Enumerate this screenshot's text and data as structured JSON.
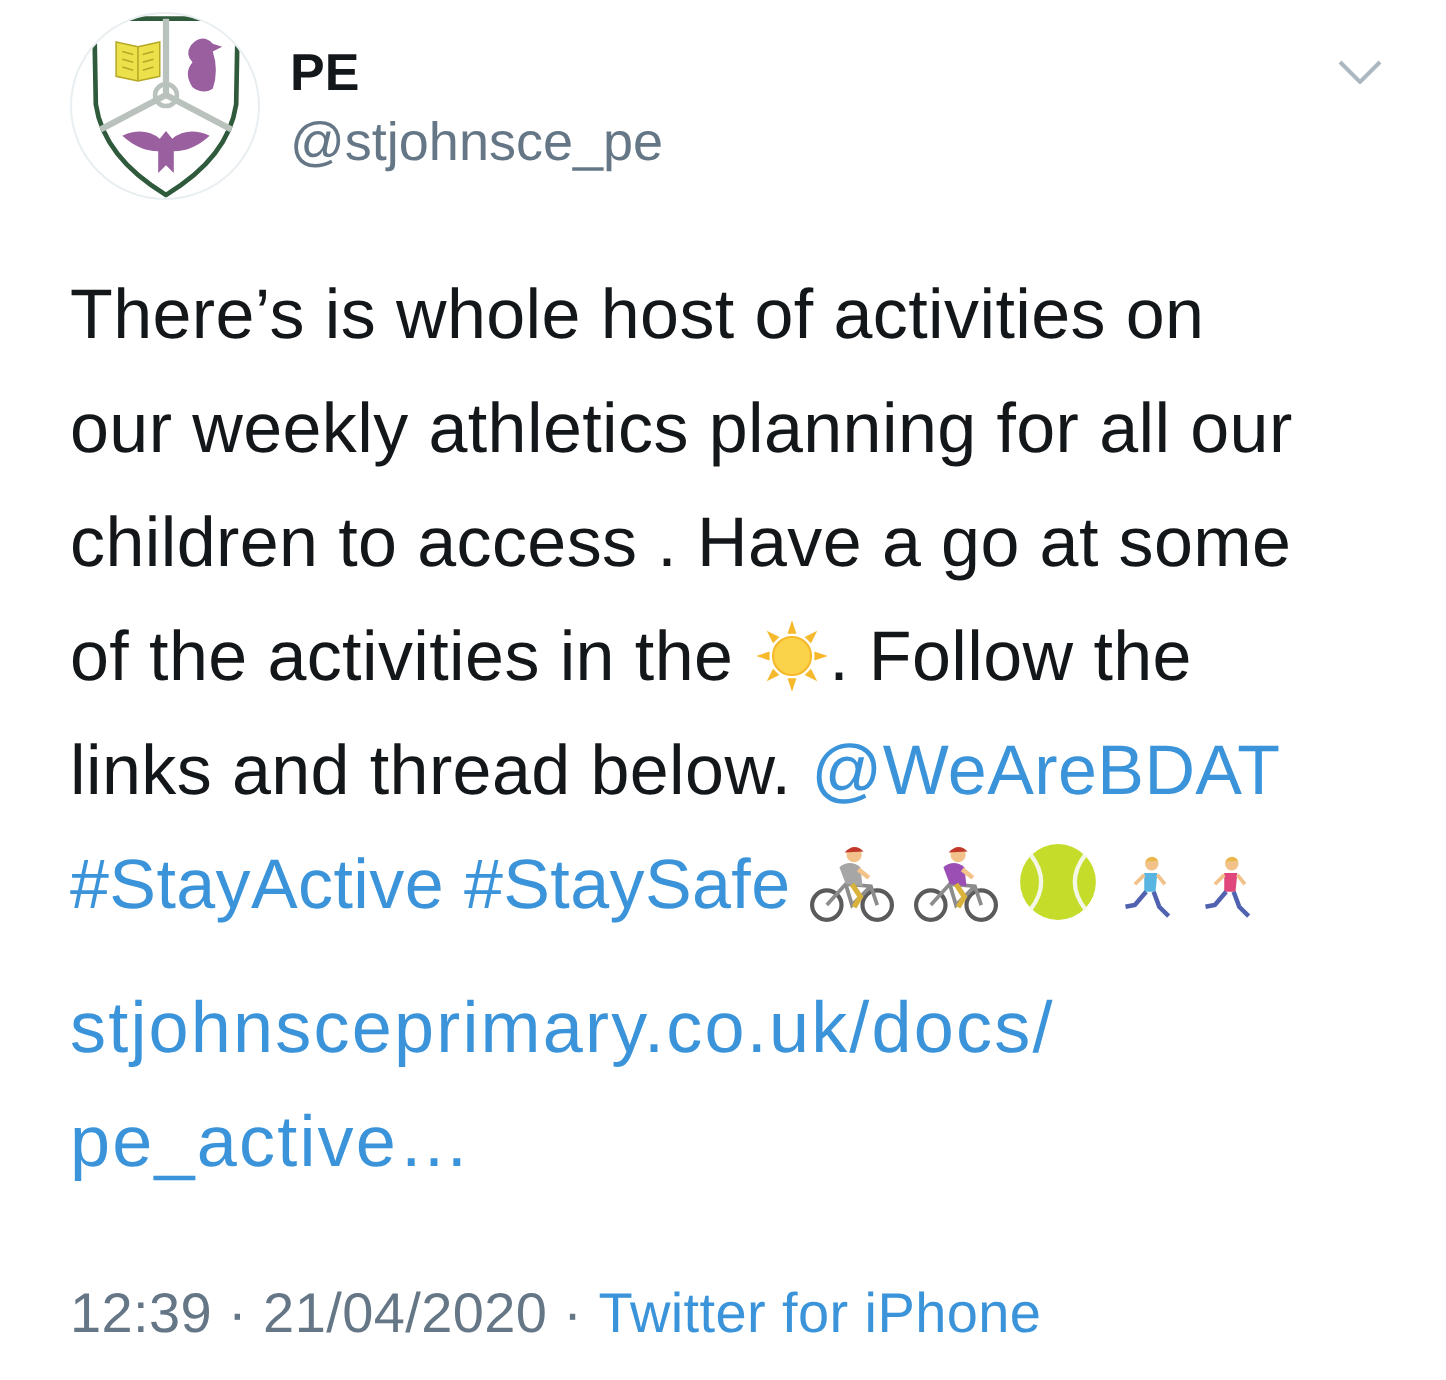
{
  "tweet": {
    "author": {
      "name": "PE",
      "handle": "@stjohnsce_pe"
    },
    "body": {
      "lines": [
        [
          {
            "kind": "text",
            "text": "There’s is whole host of activities on"
          }
        ],
        [
          {
            "kind": "text",
            "text": "our weekly athletics planning for all our"
          }
        ],
        [
          {
            "kind": "text",
            "text": "children to access . Have a go at some"
          }
        ],
        [
          {
            "kind": "text",
            "text": "of the activities in the "
          },
          {
            "kind": "sun"
          },
          {
            "kind": "text",
            "text": ". Follow the"
          }
        ],
        [
          {
            "kind": "text",
            "text": "links and thread below. "
          },
          {
            "kind": "mention",
            "text": "@WeAreBDAT"
          }
        ],
        [
          {
            "kind": "hashtag",
            "text": "#StayActive"
          },
          {
            "kind": "hashtag",
            "text": "#StaySafe"
          },
          {
            "kind": "cyclist",
            "color": "#a6a6a6"
          },
          {
            "kind": "cyclist",
            "color": "#9b4fb5"
          },
          {
            "kind": "ball"
          },
          {
            "kind": "runner",
            "color": "#58b4e0"
          },
          {
            "kind": "runner",
            "color": "#e0457b"
          }
        ]
      ]
    },
    "link": {
      "lines": [
        "stjohnsceprimary.co.uk/docs/",
        "pe_active…"
      ]
    },
    "footer": {
      "timestamp": "12:39 · 21/04/2020 ·",
      "source": "Twitter for iPhone"
    }
  }
}
